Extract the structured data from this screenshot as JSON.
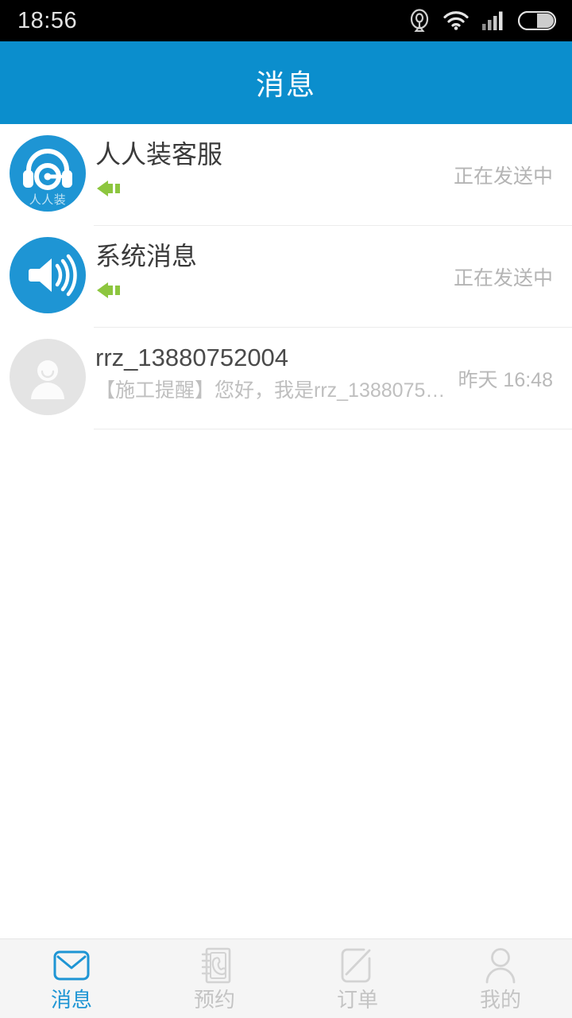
{
  "status_bar": {
    "time": "18:56",
    "icons": [
      "location-icon",
      "wifi-icon",
      "cellular-signal-icon",
      "battery-icon"
    ]
  },
  "header": {
    "title": "消息"
  },
  "colors": {
    "header_blue": "#0b8ecd",
    "accent_blue": "#1e95d4",
    "arrow_green": "#8dc63f",
    "status_text": "#b4b4b4",
    "title_text": "#3a3a3a",
    "tab_inactive": "#c4c4c4",
    "tabbar_bg": "#f5f5f5"
  },
  "conversations": [
    {
      "avatar_type": "headset-icon",
      "avatar_brand": "人人装",
      "title": "人人装客服",
      "preview": "",
      "has_sending_arrow": true,
      "meta": "正在发送中"
    },
    {
      "avatar_type": "megaphone-icon",
      "avatar_brand": "",
      "title": "系统消息",
      "preview": "",
      "has_sending_arrow": true,
      "meta": "正在发送中"
    },
    {
      "avatar_type": "person-icon",
      "avatar_brand": "",
      "title": "rrz_13880752004",
      "preview": "【施工提醒】您好，我是rrz_13880752004…",
      "has_sending_arrow": false,
      "meta": "昨天  16:48"
    }
  ],
  "tabbar": {
    "items": [
      {
        "label": "消息",
        "icon": "envelope-icon",
        "active": true
      },
      {
        "label": "预约",
        "icon": "address-book-icon",
        "active": false
      },
      {
        "label": "订单",
        "icon": "compose-note-icon",
        "active": false
      },
      {
        "label": "我的",
        "icon": "person-outline-icon",
        "active": false
      }
    ]
  }
}
